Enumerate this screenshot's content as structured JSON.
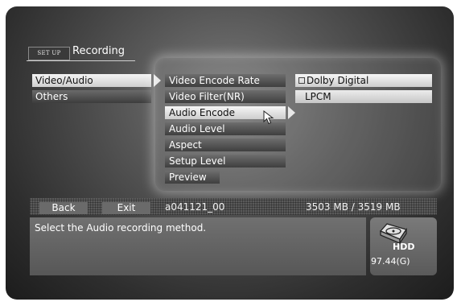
{
  "header": {
    "setup_tag": "SET UP",
    "title": "Recording"
  },
  "main_menu": {
    "items": [
      {
        "label": "Video/Audio",
        "selected": true
      },
      {
        "label": "Others",
        "selected": false
      }
    ]
  },
  "sub_menu": {
    "items": [
      {
        "label": "Video Encode Rate"
      },
      {
        "label": "Video Filter(NR)"
      },
      {
        "label": "Audio Encode",
        "active": true
      },
      {
        "label": "Audio Level"
      },
      {
        "label": "Aspect"
      },
      {
        "label": "Setup Level"
      },
      {
        "label": "Preview"
      }
    ]
  },
  "options": {
    "items": [
      {
        "label": "Dolby Digital",
        "checked": true
      },
      {
        "label": "LPCM",
        "checked": false
      }
    ]
  },
  "status_bar": {
    "back_label": "Back",
    "exit_label": "Exit",
    "file_name": "a041121_00",
    "capacity": "3503 MB / 3519 MB"
  },
  "message": {
    "text": "Select the Audio recording method."
  },
  "hdd": {
    "label": "HDD",
    "size": "97.44(G)"
  },
  "colors": {
    "highlight": "#e6e6e6",
    "panel_glow": "#ffffff",
    "menu_dark": "#4a4a4a"
  }
}
